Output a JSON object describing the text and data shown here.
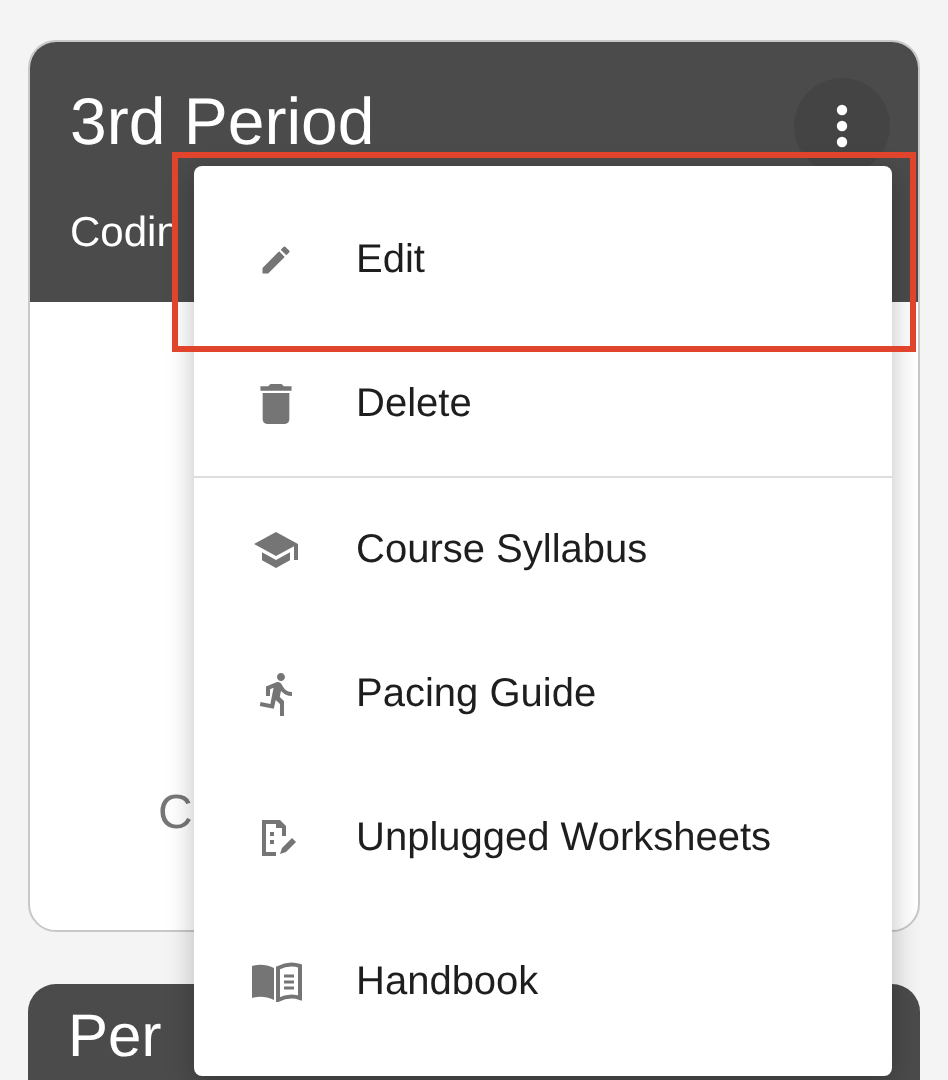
{
  "cards": [
    {
      "title": "3rd Period",
      "subtitle": "Codin",
      "body_text": "C"
    },
    {
      "title": "Per"
    }
  ],
  "menu": {
    "items": [
      {
        "label": "Edit",
        "highlighted": true,
        "divider_before": false
      },
      {
        "label": "Delete",
        "highlighted": false,
        "divider_before": false
      },
      {
        "label": "Course Syllabus",
        "highlighted": false,
        "divider_before": true
      },
      {
        "label": "Pacing Guide",
        "highlighted": false,
        "divider_before": false
      },
      {
        "label": "Unplugged Worksheets",
        "highlighted": false,
        "divider_before": false
      },
      {
        "label": "Handbook",
        "highlighted": false,
        "divider_before": false
      }
    ]
  }
}
